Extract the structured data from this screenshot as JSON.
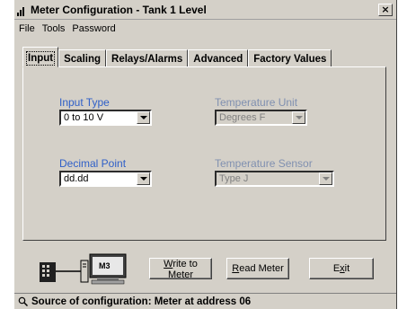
{
  "window": {
    "title": "Meter Configuration - Tank 1 Level",
    "close_label": "×"
  },
  "menu": [
    "File",
    "Tools",
    "Password"
  ],
  "tabs": [
    {
      "label": "Input",
      "active": true
    },
    {
      "label": "Scaling"
    },
    {
      "label": "Relays/Alarms"
    },
    {
      "label": "Advanced"
    },
    {
      "label": "Factory Values"
    }
  ],
  "input_type": {
    "label": "Input Type",
    "value": "0 to 10 V"
  },
  "decimal_point": {
    "label": "Decimal Point",
    "value": "dd.dd"
  },
  "temperature_unit": {
    "label": "Temperature Unit",
    "value": "Degrees F"
  },
  "temperature_sensor": {
    "label": "Temperature Sensor",
    "value": "Type J"
  },
  "buttons": {
    "write_pre": "",
    "write_u": "W",
    "write_post": "rite to Meter",
    "read_pre": "",
    "read_u": "R",
    "read_post": "ead Meter",
    "exit_pre": "E",
    "exit_u": "x",
    "exit_post": "it"
  },
  "diagram": {
    "meter_badge": "M3"
  },
  "status": {
    "text": "Source of configuration: Meter at address 06"
  },
  "colors": {
    "label_blue": "#3060c8",
    "label_disabled": "#8090b0",
    "face": "#d4d0c8"
  }
}
